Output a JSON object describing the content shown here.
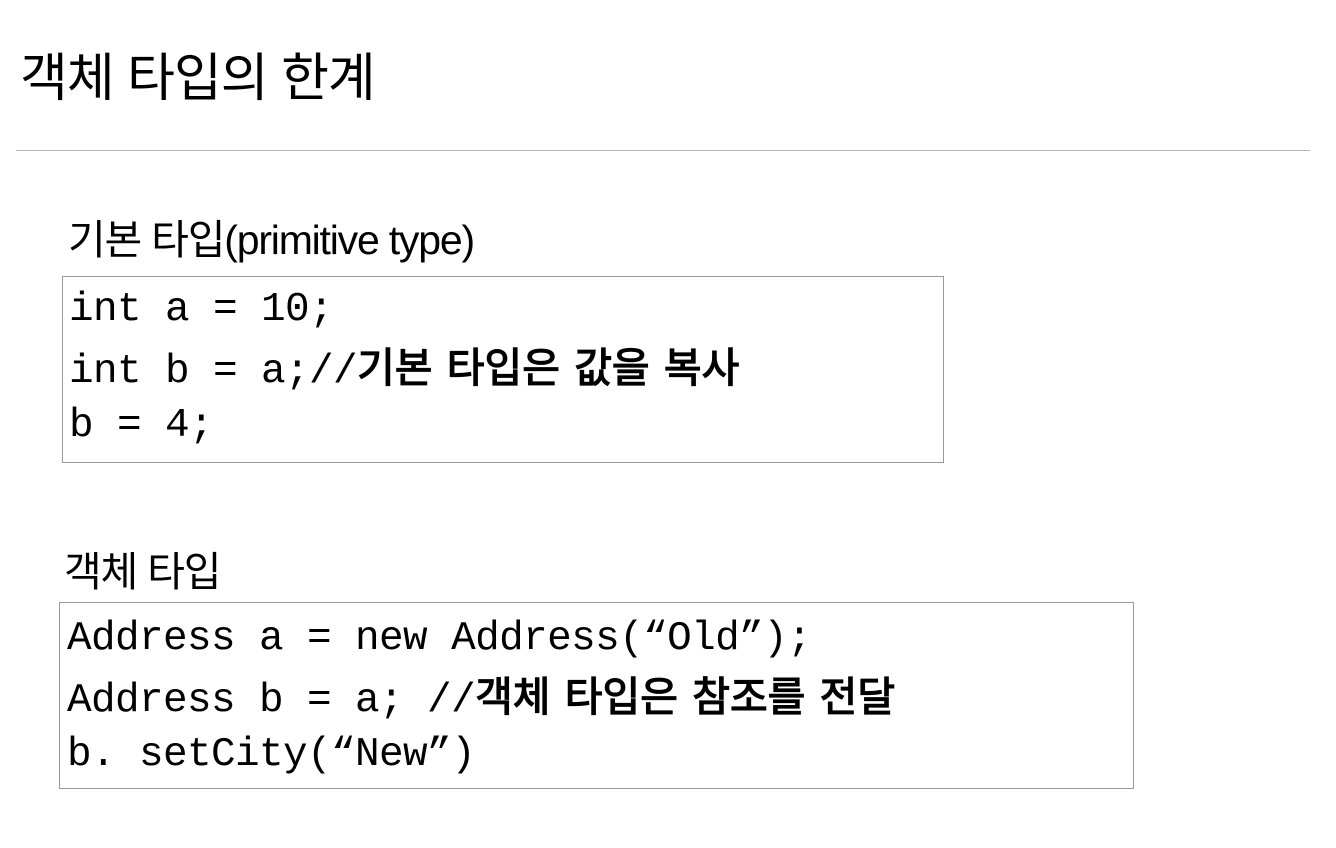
{
  "slide": {
    "title": "객체 타입의 한계"
  },
  "primitive_section": {
    "heading": "기본 타입(primitive type)",
    "lines": [
      {
        "code": "int a = 10;",
        "comment": ""
      },
      {
        "code": "int b = a;//",
        "comment": "기본 타입은 값을 복사"
      },
      {
        "code": "b = 4;",
        "comment": ""
      }
    ]
  },
  "object_section": {
    "heading": "객체 타입",
    "lines": [
      {
        "code": "Address a = new Address(“Old”);",
        "comment": ""
      },
      {
        "code": "Address b = a; //",
        "comment": "객체 타입은 참조를 전달"
      },
      {
        "code": "b. setCity(“New”)",
        "comment": ""
      }
    ]
  }
}
